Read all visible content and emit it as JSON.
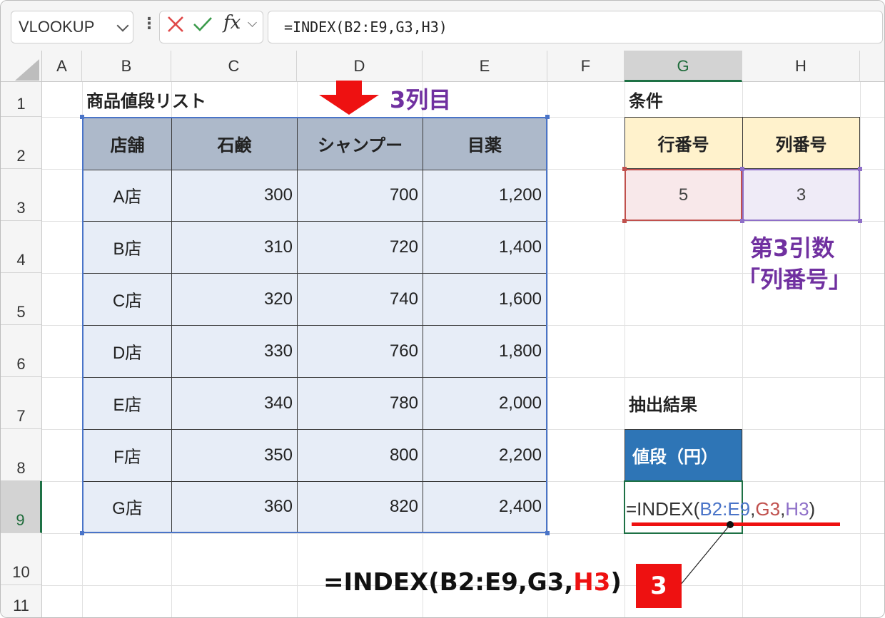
{
  "formula_bar": {
    "name_box": "VLOOKUP",
    "fx_label": "fx",
    "formula": "=INDEX(B2:E9,G3,H3)"
  },
  "columns": [
    "A",
    "B",
    "C",
    "D",
    "E",
    "F",
    "G",
    "H"
  ],
  "rows": [
    "1",
    "2",
    "3",
    "4",
    "5",
    "6",
    "7",
    "8",
    "9",
    "10",
    "11"
  ],
  "sheet": {
    "title": "商品値段リスト",
    "table": {
      "headers": [
        "店舗",
        "石鹸",
        "シャンプー",
        "目薬"
      ],
      "rows": [
        [
          "A店",
          "300",
          "700",
          "1,200"
        ],
        [
          "B店",
          "310",
          "720",
          "1,400"
        ],
        [
          "C店",
          "320",
          "740",
          "1,600"
        ],
        [
          "D店",
          "330",
          "760",
          "1,800"
        ],
        [
          "E店",
          "340",
          "780",
          "2,000"
        ],
        [
          "F店",
          "350",
          "800",
          "2,200"
        ],
        [
          "G店",
          "360",
          "820",
          "2,400"
        ]
      ]
    },
    "conditions": {
      "label": "条件",
      "row_header": "行番号",
      "col_header": "列番号",
      "row_value": "5",
      "col_value": "3"
    },
    "result": {
      "label": "抽出結果",
      "header": "値段（円）",
      "formula_prefix": "=INDEX(",
      "arg1": "B2:E9",
      "comma1": ",",
      "arg2": "G3",
      "comma2": ",",
      "arg3": "H3",
      "suffix": ")"
    }
  },
  "annotations": {
    "third_column": "3列目",
    "third_arg_line1": "第3引数",
    "third_arg_line2": "「列番号」",
    "bottom_formula_prefix": "=INDEX(B2:E9,G3,",
    "bottom_formula_arg": "H3",
    "bottom_formula_suffix": ")",
    "bottom_result": "3"
  },
  "colors": {
    "accent_green": "#1e7145",
    "table_header": "#adb9ca",
    "table_body": "#e7edf7",
    "condition_header": "#fff2cc",
    "row_value_bg": "#f8e8ea",
    "col_value_bg": "#efebf7",
    "result_header": "#2e75b6",
    "annotation_purple": "#7030a0",
    "arrow_red": "#ee1111"
  }
}
